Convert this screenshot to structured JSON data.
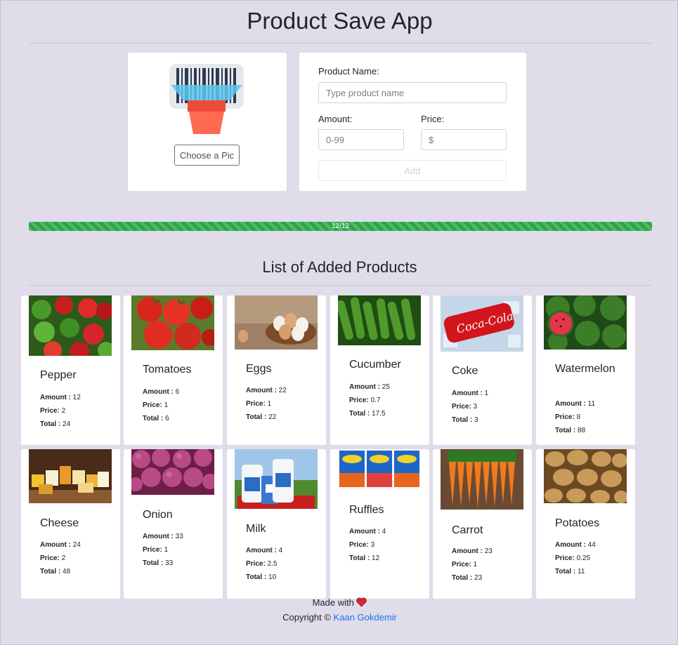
{
  "app": {
    "title": "Product Save App"
  },
  "picture": {
    "choose_label": "Choose a Pic"
  },
  "form": {
    "name_label": "Product Name:",
    "name_placeholder": "Type product name",
    "amount_label": "Amount:",
    "amount_placeholder": "0-99",
    "price_label": "Price:",
    "price_placeholder": "$",
    "add_label": "Add"
  },
  "progress": {
    "text": "12/12",
    "percent": 100
  },
  "list": {
    "title": "List of Added Products",
    "amount_label": "Amount :",
    "price_label": "Price:",
    "total_label": "Total :"
  },
  "products": [
    {
      "name": "Pepper",
      "amount": "12",
      "price": "2",
      "total": "24",
      "image": "pepper-image"
    },
    {
      "name": "Tomatoes",
      "amount": "6",
      "price": "1",
      "total": "6",
      "image": "tomatoes-image"
    },
    {
      "name": "Eggs",
      "amount": "22",
      "price": "1",
      "total": "22",
      "image": "eggs-image"
    },
    {
      "name": "Cucumber",
      "amount": "25",
      "price": "0.7",
      "total": "17.5",
      "image": "cucumber-image"
    },
    {
      "name": "Coke",
      "amount": "1",
      "price": "3",
      "total": "3",
      "image": "coke-image"
    },
    {
      "name": "Watermelon",
      "amount": "11",
      "price": "8",
      "total": "88",
      "image": "watermelon-image"
    },
    {
      "name": "Cheese",
      "amount": "24",
      "price": "2",
      "total": "48",
      "image": "cheese-image"
    },
    {
      "name": "Onion",
      "amount": "33",
      "price": "1",
      "total": "33",
      "image": "onion-image"
    },
    {
      "name": "Milk",
      "amount": "4",
      "price": "2.5",
      "total": "10",
      "image": "milk-image"
    },
    {
      "name": "Ruffles",
      "amount": "4",
      "price": "3",
      "total": "12",
      "image": "ruffles-image"
    },
    {
      "name": "Carrot",
      "amount": "23",
      "price": "1",
      "total": "23",
      "image": "carrot-image"
    },
    {
      "name": "Potatoes",
      "amount": "44",
      "price": "0.25",
      "total": "11",
      "image": "potatoes-image"
    }
  ],
  "footer": {
    "made_with": "Made with",
    "heart_icon": "heart-icon",
    "copyright": "Copyright ©",
    "author": "Kaan Gokdemir"
  },
  "colors": {
    "background": "#e0dcea",
    "progress": "#28a745",
    "link": "#1a73e8"
  }
}
